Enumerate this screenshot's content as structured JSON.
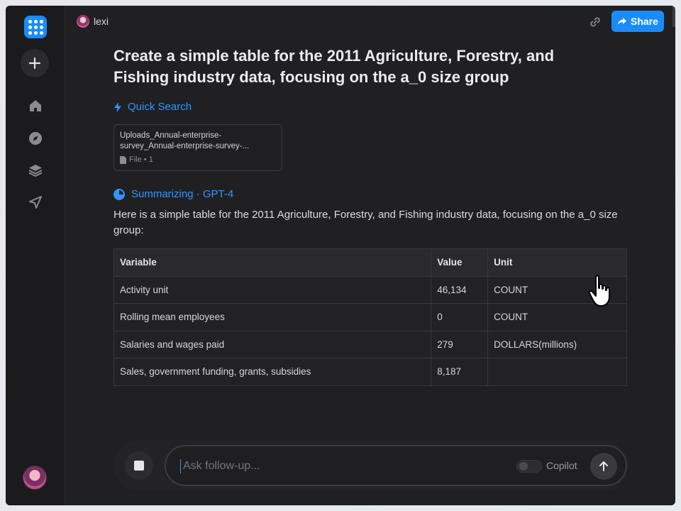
{
  "header": {
    "username": "lexi",
    "share_label": "Share"
  },
  "query": {
    "title": "Create a simple table for the 2011 Agriculture, Forestry, and Fishing industry data, focusing on the a_0 size group"
  },
  "quick_search": {
    "label": "Quick Search"
  },
  "file_card": {
    "name": "Uploads_Annual-enterprise-survey_Annual-enterprise-survey-...",
    "meta": "File • 1"
  },
  "summarizing": {
    "label": "Summarizing · GPT-4"
  },
  "answer": {
    "intro": "Here is a simple table for the 2011 Agriculture, Forestry, and Fishing industry data, focusing on the a_0 size group:",
    "headers": [
      "Variable",
      "Value",
      "Unit"
    ],
    "rows": [
      [
        "Activity unit",
        "46,134",
        "COUNT"
      ],
      [
        "Rolling mean employees",
        "0",
        "COUNT"
      ],
      [
        "Salaries and wages paid",
        "279",
        "DOLLARS(millions)"
      ],
      [
        "Sales, government funding, grants, subsidies",
        "8,187",
        ""
      ]
    ]
  },
  "composer": {
    "placeholder": "Ask follow-up...",
    "copilot_label": "Copilot"
  },
  "icons": {
    "logo": "grid-icon",
    "new": "plus-icon",
    "home": "home-icon",
    "discover": "compass-icon",
    "library": "layers-icon",
    "send": "navigation-icon",
    "link": "link-icon",
    "share": "share-arrow-icon",
    "quick_search": "bolt-icon",
    "file": "document-icon",
    "stop": "stop-icon",
    "submit": "arrow-up-icon"
  },
  "colors": {
    "accent": "#1a8cff",
    "background": "#202023",
    "rail": "#1b1b1e"
  }
}
